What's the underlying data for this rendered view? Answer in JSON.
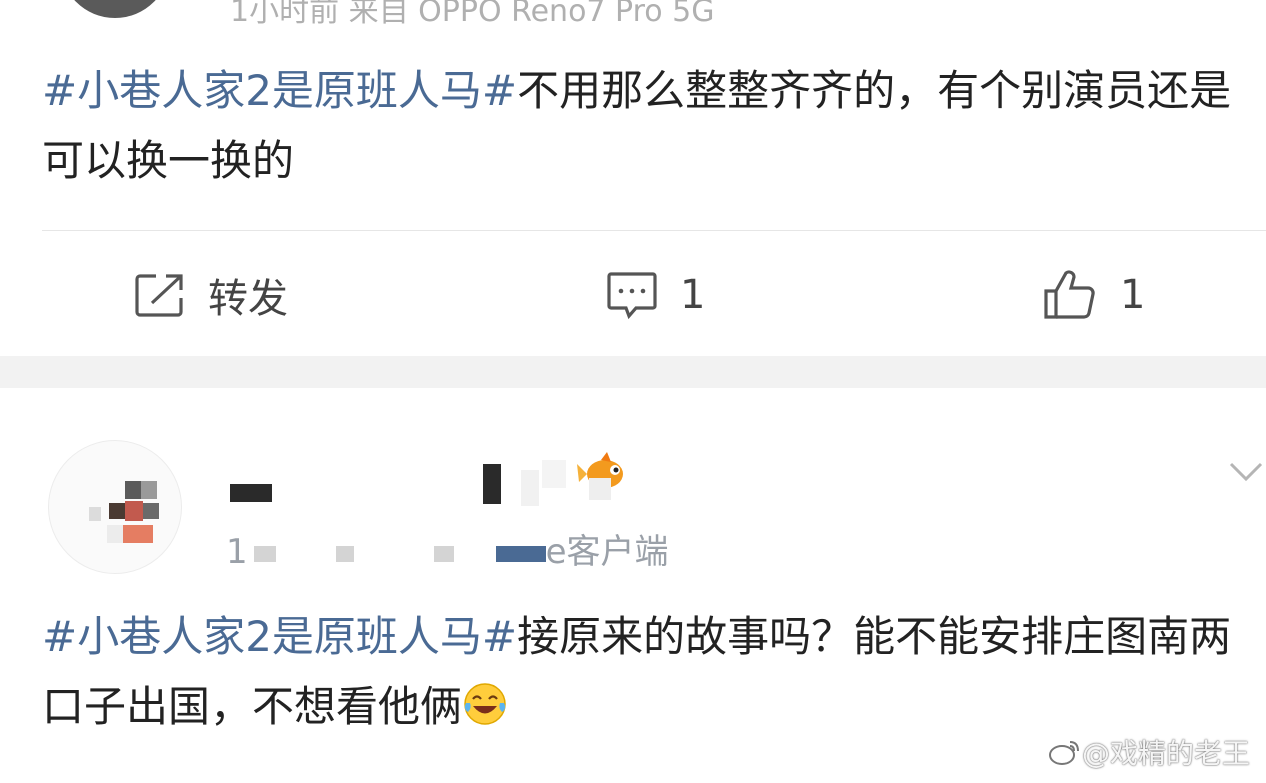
{
  "post1": {
    "meta_partial": "1小时前 来自 OPPO Reno7 Pro 5G",
    "hashtag": "#小巷人家2是原班人马#",
    "body": "不用那么整整齐齐的，有个别演员还是可以换一换的",
    "actions": {
      "forward_label": "转发",
      "comment_count": "1",
      "like_count": "1"
    }
  },
  "post2": {
    "source_prefix": "1",
    "source_suffix": "e客户端",
    "hashtag": "#小巷人家2是原班人马#",
    "body": "接原来的故事吗？能不能安排庄图南两口子出国，不想看他俩",
    "emoji": "laughing-tears-emoji"
  },
  "watermark": "@戏精的老王",
  "colors": {
    "hashtag": "#4a6a94",
    "divider_band": "#f2f2f2",
    "text": "#222222",
    "meta": "#9aa0a8"
  }
}
